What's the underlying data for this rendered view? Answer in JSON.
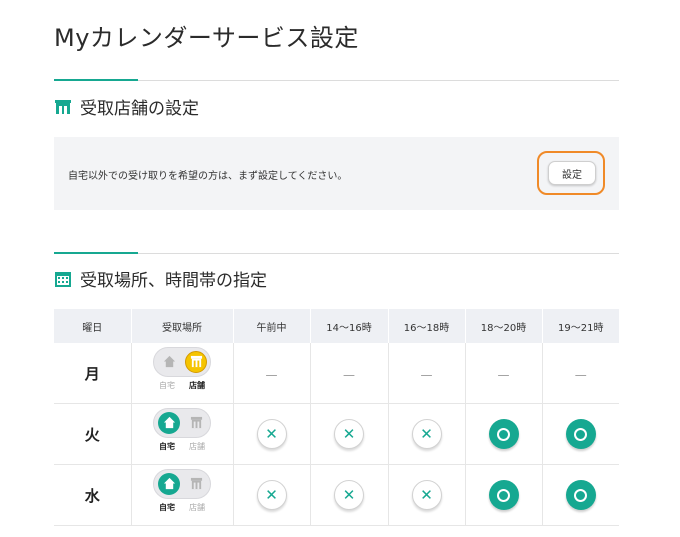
{
  "page": {
    "title": "Myカレンダーサービス設定"
  },
  "store_section": {
    "title": "受取店舗の設定",
    "message": "自宅以外での受け取りを希望の方は、まず設定してください。",
    "button_label": "設定"
  },
  "schedule_section": {
    "title": "受取場所、時間帯の指定",
    "headers": [
      "曜日",
      "受取場所",
      "午前中",
      "14〜16時",
      "16〜18時",
      "18〜20時",
      "19〜21時"
    ],
    "location_labels": {
      "home": "自宅",
      "store": "店舗"
    },
    "dash": "—",
    "rows": [
      {
        "day": "月",
        "location": "store",
        "slots": [
          "dash",
          "dash",
          "dash",
          "dash",
          "dash"
        ]
      },
      {
        "day": "火",
        "location": "home",
        "slots": [
          "x",
          "x",
          "x",
          "o",
          "o"
        ]
      },
      {
        "day": "水",
        "location": "home",
        "slots": [
          "x",
          "x",
          "x",
          "o",
          "o"
        ]
      }
    ]
  },
  "colors": {
    "accent": "#16a891",
    "store_active": "#f5c400",
    "highlight": "#f08a28"
  },
  "icons": {
    "store_section": "shop-icon",
    "schedule_section": "calendar-icon"
  }
}
